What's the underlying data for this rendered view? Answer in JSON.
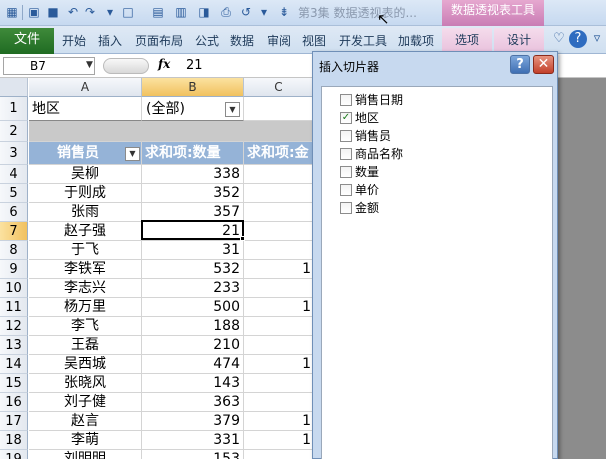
{
  "window": {
    "title": "第3集 数据透视表的...",
    "contextual_tool_title": "数据透视表工具",
    "accent_color": "#c97cb4",
    "file_tab_color": "#1f6b22"
  },
  "ribbon": {
    "file_tab": "文件",
    "tabs": [
      "开始",
      "插入",
      "页面布局",
      "公式",
      "数据",
      "审阅",
      "视图",
      "开发工具",
      "加载项"
    ],
    "pivot_tabs": [
      "选项",
      "设计"
    ],
    "right_icons": [
      "minimize-ribbon-icon",
      "help-icon"
    ]
  },
  "formula_bar": {
    "name_box": "B7",
    "fx_label": "fx",
    "value": "21"
  },
  "sheet": {
    "columns": [
      "A",
      "B",
      "C"
    ],
    "selected_column": "B",
    "selected_row": "7",
    "page_filter": {
      "row": "1",
      "label": "地区",
      "value": "(全部)"
    },
    "row2": "2",
    "header_row": {
      "row": "3",
      "col_a": "销售员",
      "col_b": "求和项:数量",
      "col_c": "求和项:金"
    },
    "header_color": "#95b3d7",
    "rows": [
      {
        "row": "4",
        "name": "吴柳",
        "qty": "338",
        "c": ""
      },
      {
        "row": "5",
        "name": "于则成",
        "qty": "352",
        "c": ""
      },
      {
        "row": "6",
        "name": "张雨",
        "qty": "357",
        "c": ""
      },
      {
        "row": "7",
        "name": "赵子强",
        "qty": "21",
        "c": ""
      },
      {
        "row": "8",
        "name": "于飞",
        "qty": "31",
        "c": ""
      },
      {
        "row": "9",
        "name": "李铁军",
        "qty": "532",
        "c": "1"
      },
      {
        "row": "10",
        "name": "李志兴",
        "qty": "233",
        "c": ""
      },
      {
        "row": "11",
        "name": "杨万里",
        "qty": "500",
        "c": "1"
      },
      {
        "row": "12",
        "name": "李飞",
        "qty": "188",
        "c": ""
      },
      {
        "row": "13",
        "name": "王磊",
        "qty": "210",
        "c": ""
      },
      {
        "row": "14",
        "name": "吴西城",
        "qty": "474",
        "c": "1"
      },
      {
        "row": "15",
        "name": "张晓风",
        "qty": "143",
        "c": ""
      },
      {
        "row": "16",
        "name": "刘子健",
        "qty": "363",
        "c": ""
      },
      {
        "row": "17",
        "name": "赵言",
        "qty": "379",
        "c": "1"
      },
      {
        "row": "18",
        "name": "李萌",
        "qty": "331",
        "c": "1"
      },
      {
        "row": "19",
        "name": "刘明明",
        "qty": "153",
        "c": ""
      }
    ]
  },
  "dialog": {
    "title": "插入切片器",
    "help_label": "?",
    "close_label": "✕",
    "fields": [
      {
        "label": "销售日期",
        "checked": false
      },
      {
        "label": "地区",
        "checked": true
      },
      {
        "label": "销售员",
        "checked": false
      },
      {
        "label": "商品名称",
        "checked": false
      },
      {
        "label": "数量",
        "checked": false
      },
      {
        "label": "单价",
        "checked": false
      },
      {
        "label": "金额",
        "checked": false
      }
    ]
  }
}
